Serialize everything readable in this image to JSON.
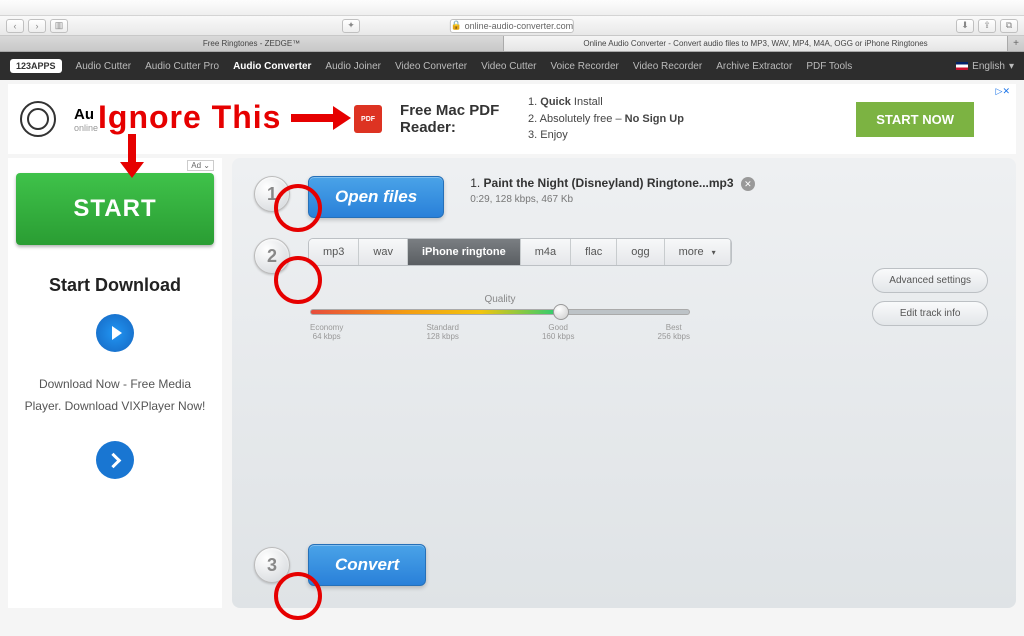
{
  "browser": {
    "url": "online-audio-converter.com",
    "lock_prefix": "🔒",
    "tabs": [
      {
        "title": "Free Ringtones - ZEDGE™"
      },
      {
        "title": "Online Audio Converter - Convert audio files to MP3, WAV, MP4, M4A, OGG or iPhone Ringtones"
      }
    ]
  },
  "nav": {
    "logo": "123APPS",
    "items": [
      "Audio Cutter",
      "Audio Cutter Pro",
      "Audio Converter",
      "Audio Joiner",
      "Video Converter",
      "Video Cutter",
      "Voice Recorder",
      "Video Recorder",
      "Archive Extractor",
      "PDF Tools"
    ],
    "active_index": 2,
    "language": "English"
  },
  "annotation": {
    "ignore_text": "Ignore This"
  },
  "banner": {
    "app_title_short": "Au",
    "app_sub": "online",
    "pdf_icon": "PDF",
    "pdf_title": "Free Mac PDF Reader:",
    "features": [
      {
        "n": "1.",
        "bold": "Quick",
        "rest": " Install"
      },
      {
        "n": "2.",
        "bold": "No Sign Up",
        "rest": "Absolutely free – "
      },
      {
        "n": "3.",
        "bold": "",
        "rest": "Enjoy"
      }
    ],
    "feat1_pre": "1. ",
    "feat1_b": "Quick",
    "feat1_post": " Install",
    "feat2_pre": "2. Absolutely free – ",
    "feat2_b": "No Sign Up",
    "feat3": "3. Enjoy",
    "cta": "START NOW",
    "adchoices": "▷✕"
  },
  "sidebar": {
    "ad_badge": "Ad ⌄",
    "start": "START",
    "title": "Start Download",
    "desc": "Download Now - Free Media Player. Download VIXPlayer Now!"
  },
  "converter": {
    "steps": [
      "1",
      "2",
      "3"
    ],
    "open_files": "Open files",
    "file": {
      "index": "1.",
      "name": "Paint the Night (Disneyland) Ringtone...mp3",
      "meta": "0:29, 128 kbps, 467 Kb"
    },
    "formats": [
      "mp3",
      "wav",
      "iPhone ringtone",
      "m4a",
      "flac",
      "ogg",
      "more"
    ],
    "format_selected_index": 2,
    "more_arrow": "▾",
    "quality": {
      "label": "Quality",
      "marks": [
        {
          "name": "Economy",
          "rate": "64 kbps"
        },
        {
          "name": "Standard",
          "rate": "128 kbps"
        },
        {
          "name": "Good",
          "rate": "160 kbps"
        },
        {
          "name": "Best",
          "rate": "256 kbps"
        }
      ]
    },
    "advanced": "Advanced settings",
    "edit_track": "Edit track info",
    "convert": "Convert"
  }
}
